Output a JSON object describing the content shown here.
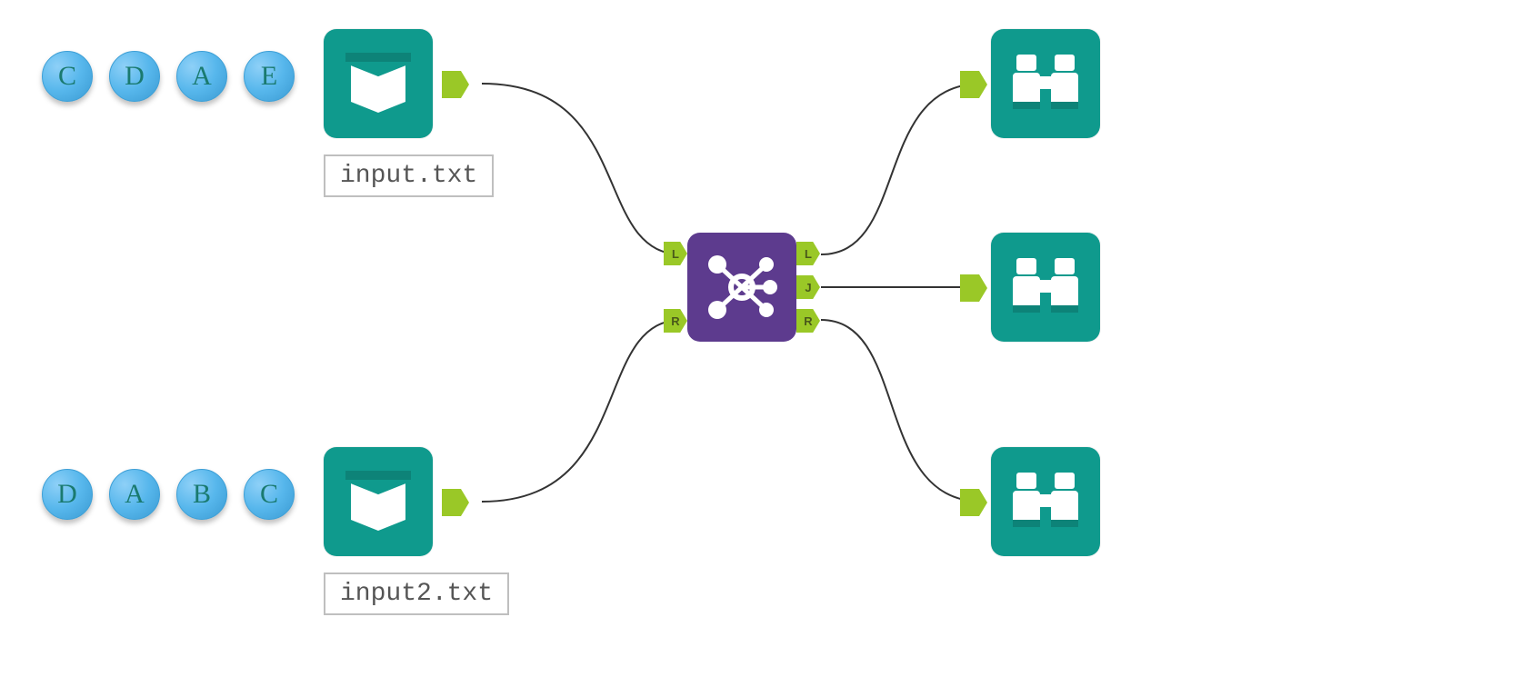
{
  "letter_rows": {
    "top": [
      "C",
      "D",
      "A",
      "E"
    ],
    "bottom": [
      "D",
      "A",
      "B",
      "C"
    ]
  },
  "inputs": {
    "file1": {
      "label": "input.txt"
    },
    "file2": {
      "label": "input2.txt"
    }
  },
  "join_tool": {
    "in_ports": [
      "L",
      "R"
    ],
    "out_ports": [
      "L",
      "J",
      "R"
    ]
  },
  "colors": {
    "teal": "#0f9a8d",
    "purple": "#5d3b8e",
    "port": "#9ac827",
    "letter_bg": "#57b7ec"
  }
}
